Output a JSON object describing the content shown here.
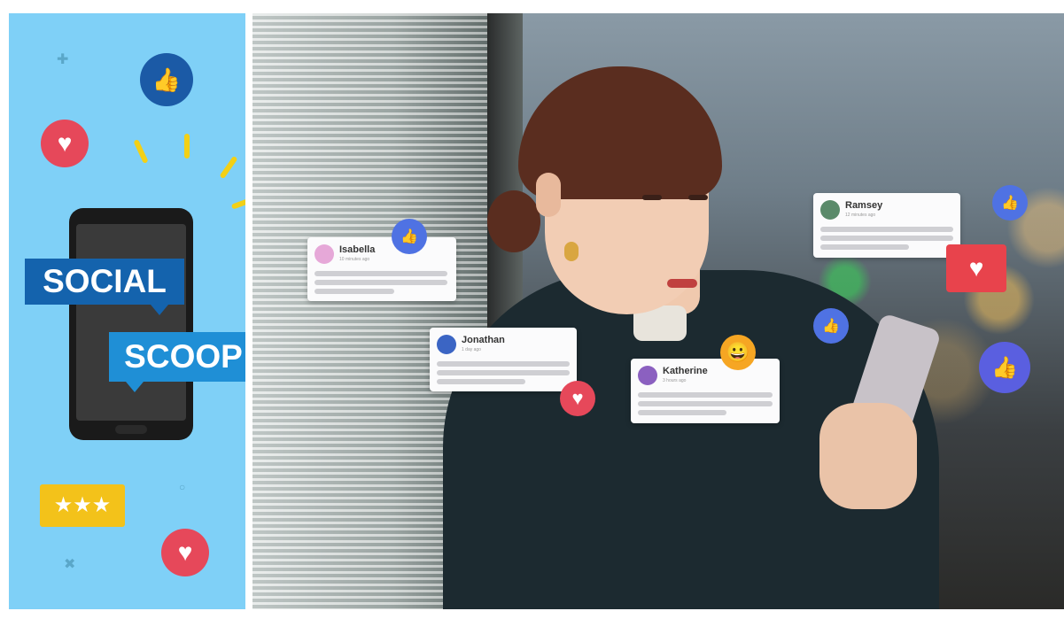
{
  "banner": {
    "tag_top": "SOCIAL",
    "tag_bottom": "SCOOP",
    "stars": "★★★"
  },
  "icons": {
    "thumbs_up": "👍",
    "heart": "♥",
    "smile": "😀"
  },
  "cards": [
    {
      "name": "Isabella",
      "time": "10 minutes ago"
    },
    {
      "name": "Jonathan",
      "time": "1 day ago"
    },
    {
      "name": "Katherine",
      "time": "3 hours ago"
    },
    {
      "name": "Ramsey",
      "time": "12 minutes ago"
    }
  ],
  "colors": {
    "panel": "#7fd0f7",
    "social_tag": "#1463ad",
    "scoop_tag": "#1f8fd6",
    "heart": "#e8434c",
    "like": "#4267e0"
  }
}
